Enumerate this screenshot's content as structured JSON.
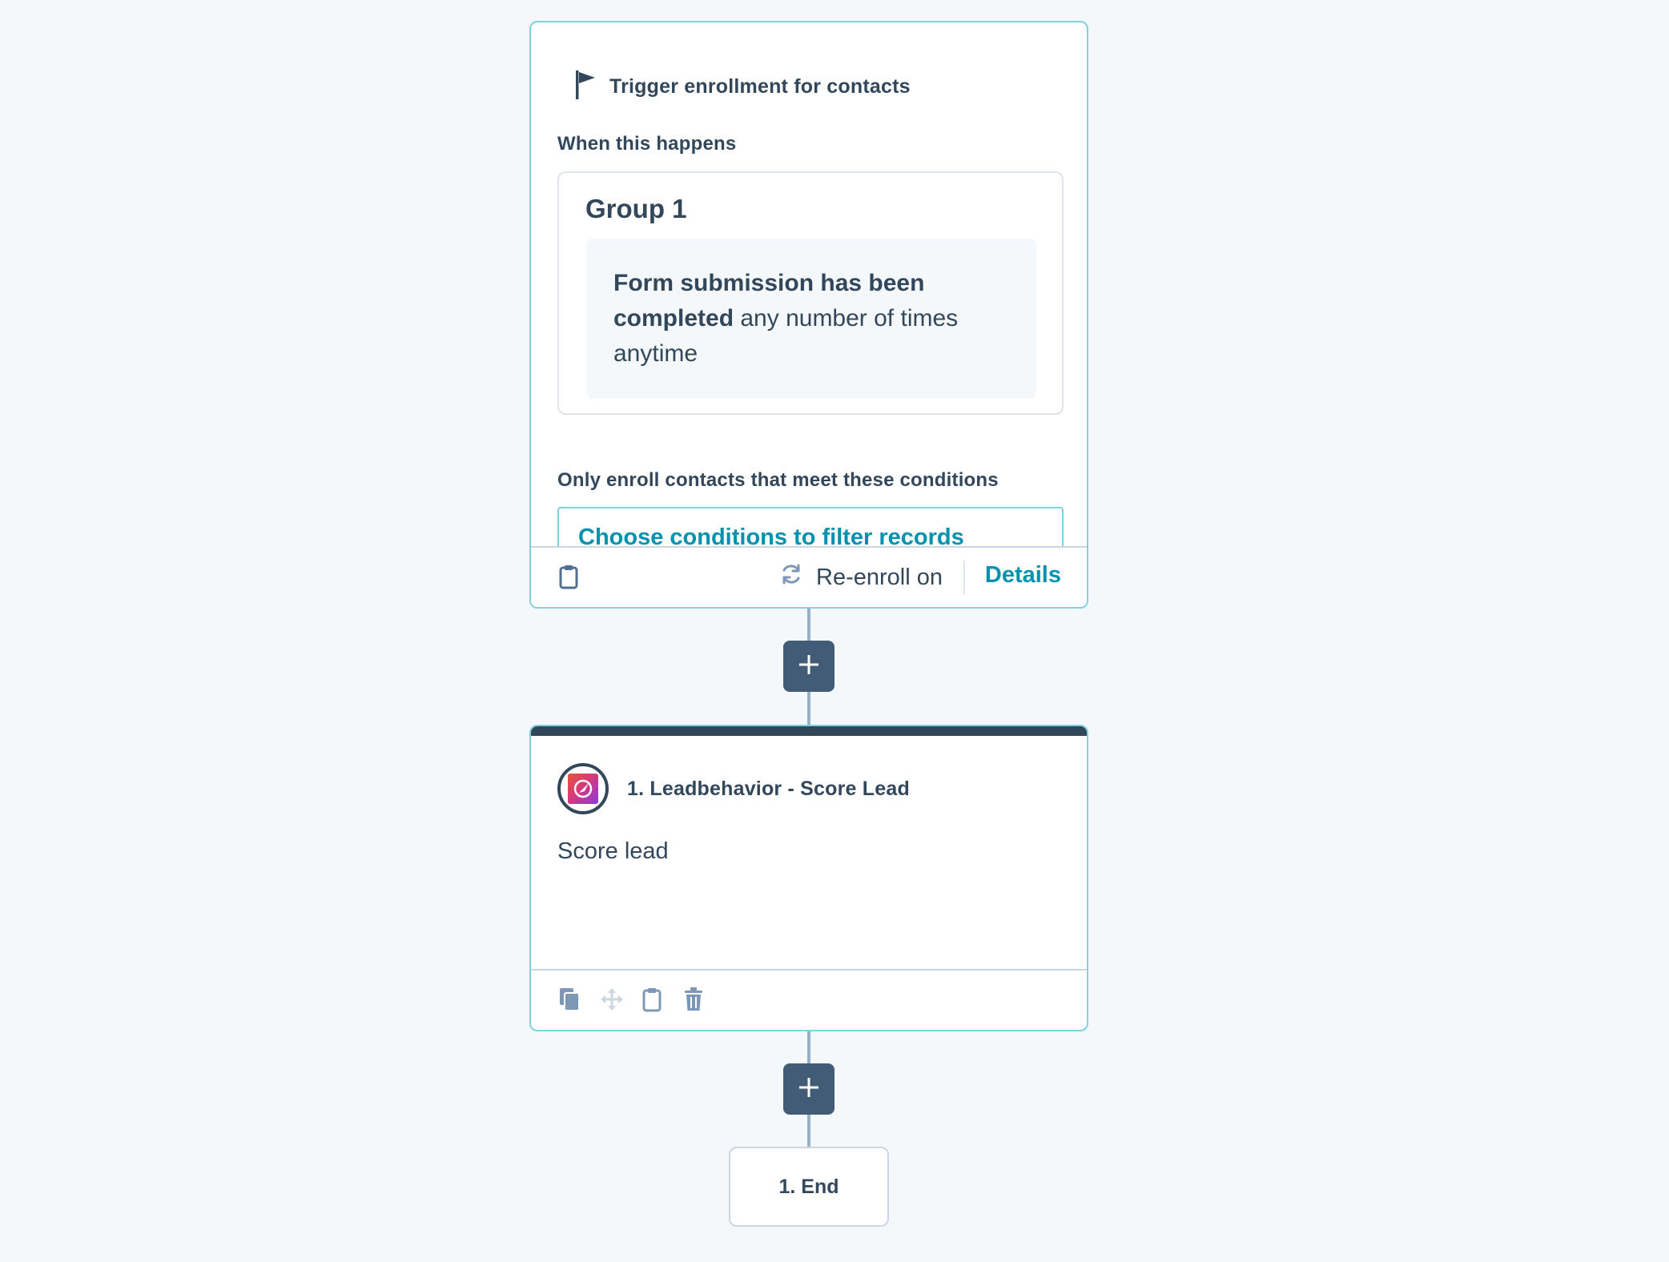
{
  "trigger": {
    "title": "Trigger enrollment for contacts",
    "when_label": "When this happens",
    "group_title": "Group 1",
    "filter_bold": "Form submission has been completed",
    "filter_rest": " any number of times anytime",
    "conditions_label": "Only enroll contacts that meet these conditions",
    "choose_conditions": "Choose conditions to filter records",
    "reenroll_label": "Re-enroll on",
    "details_label": "Details"
  },
  "action": {
    "title": "1. Leadbehavior - Score Lead",
    "description": "Score lead"
  },
  "end": {
    "label": "1. End"
  },
  "colors": {
    "accent": "#0091ae",
    "border": "#7fd1de",
    "dark": "#33475b",
    "add_button": "#425b76"
  }
}
